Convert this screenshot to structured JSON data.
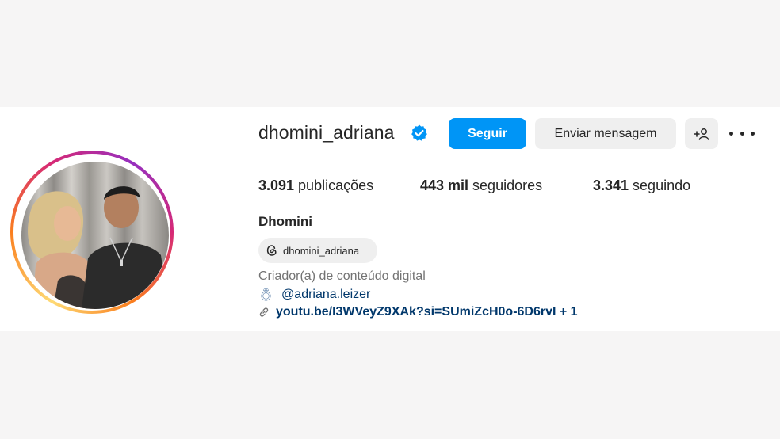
{
  "profile": {
    "username": "dhomini_adriana",
    "verified_icon": "verified-badge-icon",
    "full_name": "Dhomini",
    "threads_handle": "dhomini_adriana",
    "category": "Criador(a) de conteúdo digital",
    "mention": "@adriana.leizer",
    "link": "youtu.be/I3WVeyZ9XAk?si=SUmiZcH0o-6D6rvI + 1"
  },
  "actions": {
    "follow_label": "Seguir",
    "message_label": "Enviar mensagem",
    "suggest_icon": "add-person-icon",
    "more_icon": "more-options-icon"
  },
  "stats": {
    "posts_count": "3.091",
    "posts_label": " publicações",
    "followers_count": "443 mil",
    "followers_label": " seguidores",
    "following_count": "3.341",
    "following_label": " seguindo"
  },
  "colors": {
    "primary_button": "#0095f6",
    "secondary_button": "#efefef",
    "link": "#00376b",
    "verified": "#0095f6"
  }
}
